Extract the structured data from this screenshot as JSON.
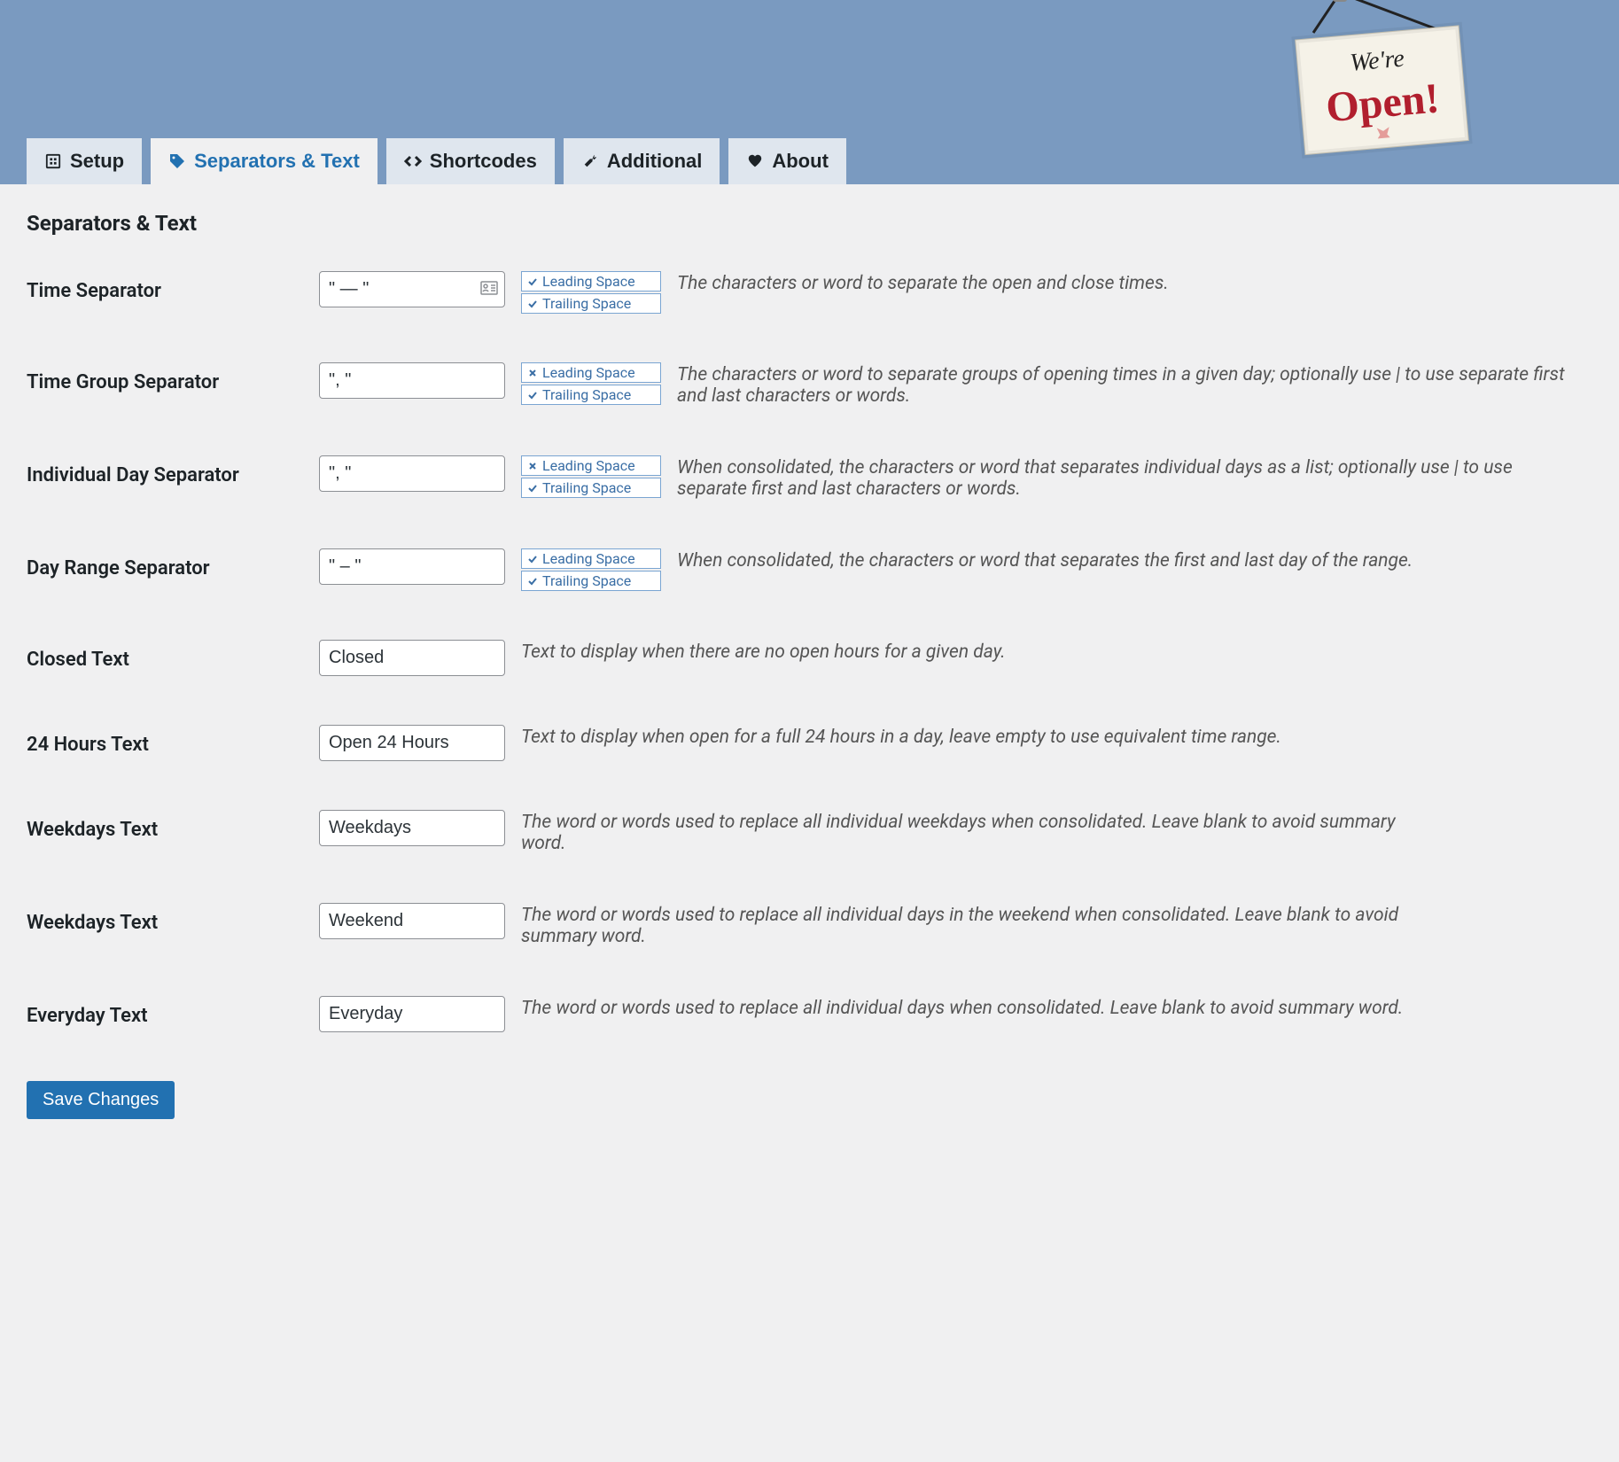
{
  "tabs": [
    {
      "label": "Setup"
    },
    {
      "label": "Separators & Text"
    },
    {
      "label": "Shortcodes"
    },
    {
      "label": "Additional"
    },
    {
      "label": "About"
    }
  ],
  "sign": {
    "top": "We're",
    "bottom": "Open!"
  },
  "page": {
    "title": "Separators & Text"
  },
  "fields": {
    "time_sep": {
      "label": "Time Separator",
      "value": "\" — \"",
      "leading": {
        "label": "Leading Space",
        "on": true
      },
      "trailing": {
        "label": "Trailing Space",
        "on": true
      },
      "help": "The characters or word to separate the open and close times."
    },
    "time_group_sep": {
      "label": "Time Group Separator",
      "value": "\", \"",
      "leading": {
        "label": "Leading Space",
        "on": false
      },
      "trailing": {
        "label": "Trailing Space",
        "on": true
      },
      "help": "The characters or word to separate groups of opening times in a given day; optionally use | to use separate first and last characters or words."
    },
    "ind_day_sep": {
      "label": "Individual Day Separator",
      "value": "\", \"",
      "leading": {
        "label": "Leading Space",
        "on": false
      },
      "trailing": {
        "label": "Trailing Space",
        "on": true
      },
      "help": "When consolidated, the characters or word that separates individual days as a list; optionally use | to use separate first and last characters or words."
    },
    "day_range_sep": {
      "label": "Day Range Separator",
      "value": "\" – \"",
      "leading": {
        "label": "Leading Space",
        "on": true
      },
      "trailing": {
        "label": "Trailing Space",
        "on": true
      },
      "help": "When consolidated, the characters or word that separates the first and last day of the range."
    },
    "closed": {
      "label": "Closed Text",
      "value": "Closed",
      "help": "Text to display when there are no open hours for a given day."
    },
    "hours24": {
      "label": "24 Hours Text",
      "value": "Open 24 Hours",
      "help": "Text to display when open for a full 24 hours in a day, leave empty to use equivalent time range."
    },
    "weekdays": {
      "label": "Weekdays Text",
      "value": "Weekdays",
      "help": "The word or words used to replace all individual weekdays when consolidated. Leave blank to avoid summary word."
    },
    "weekend": {
      "label": "Weekdays Text",
      "value": "Weekend",
      "help": "The word or words used to replace all individual days in the weekend when consolidated. Leave blank to avoid summary word."
    },
    "everyday": {
      "label": "Everyday Text",
      "value": "Everyday",
      "help": "The word or words used to replace all individual days when consolidated. Leave blank to avoid summary word."
    }
  },
  "buttons": {
    "save": "Save Changes"
  }
}
